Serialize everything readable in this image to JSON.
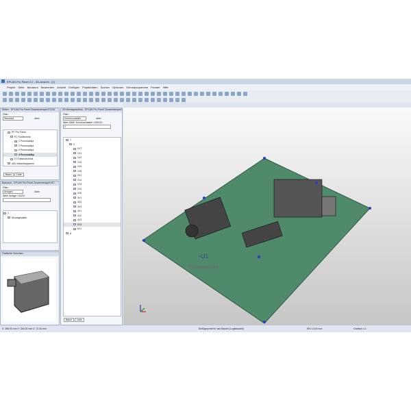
{
  "title": "EPLAN Pro Panel 2.2 - 3D-Ansicht - [1]",
  "menu": [
    "Projekt",
    "Seite",
    "Bauraum",
    "Bearbeiten",
    "Ansicht",
    "Einfügen",
    "Projektdaten",
    "Suchen",
    "Optionen",
    "Dienstprogramme",
    "Fenster",
    "Hilfe"
  ],
  "pages_panel": {
    "header": "Seiten - EPLAN Pro Panel Zusammenspiel ECAD",
    "filter_label": "Filter:",
    "filter_value": "Standard",
    "active_label": "Aktiv",
    "tree": [
      "PP Pro Panel",
      "FL Fluidtechnik",
      "1 Pneumatikpl",
      "2 Pneumatikpl",
      "3 Pneumatikpl",
      "4 Pneumatikp",
      "ET Elektrotechnik",
      "ABL Ablaufdiagramm"
    ],
    "tabs": [
      "Baum",
      "Liste"
    ]
  },
  "space_panel": {
    "header": "Bauraum - EPLAN Pro Panel Zusammenspiel EC",
    "filter_label": "Filter:",
    "filter_value": "Anlagen",
    "active_label": "Aktiv",
    "value_label": "Wert: Anlage <1120>",
    "tree": [
      "1",
      "Montageplatte"
    ]
  },
  "preview_panel": {
    "header": "Grafische Vorschau"
  },
  "mount_panel": {
    "header": "3D-Montageaufbau - EPLAN Pro Panel Zusammenspiel",
    "filter_label": "Filter:",
    "filter_value": "Kennbuchstabe",
    "active_label": "Aktiv",
    "value_label": "Wert: BMK: Kennbuchstabe <20013>",
    "value_input": "V",
    "root": "1",
    "group": "V",
    "items": [
      "0VT",
      "1V1",
      "1V2",
      "1V3",
      "1V4",
      "1V5",
      "2V1",
      "2V2",
      "2V3",
      "2V4",
      "2V5",
      "3V1",
      "3V2",
      "3V3",
      "4V1",
      "4V2",
      "4V3",
      "5V3",
      "6V1"
    ],
    "last": "8",
    "tabs": [
      "Baum",
      "Liste"
    ]
  },
  "viewport": {
    "plate_label": "-U1",
    "plate_sub": "Montageplatte"
  },
  "status": {
    "coords": "X: 356,94 mm   Y: 340,00 mm   Z: 72,34 mm",
    "hint": "Einfügepunkt für das Bauteil (Logikbauteil)",
    "grid": "EIN 10,00 mm",
    "scale": "Grafisch 1:1"
  }
}
